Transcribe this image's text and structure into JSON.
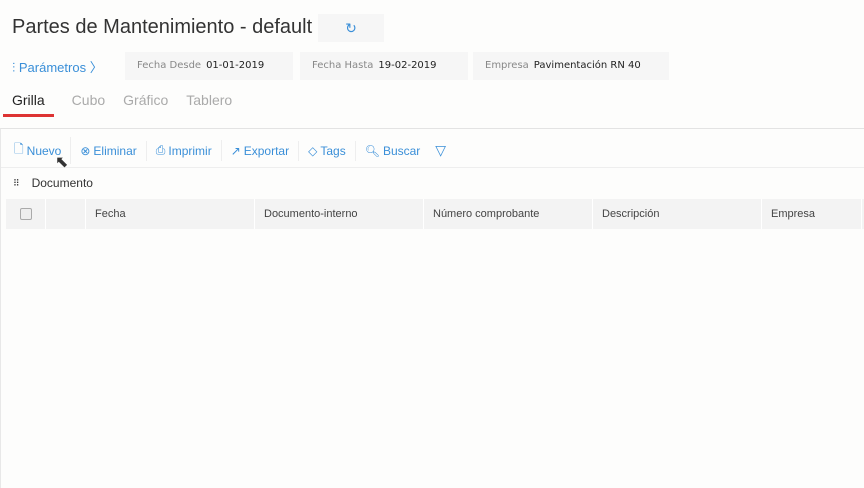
{
  "header": {
    "title": "Partes de Mantenimiento - default",
    "refresh_icon": "refresh-icon"
  },
  "params": {
    "link": "Parámetros",
    "filters": [
      {
        "label": "Fecha Desde",
        "value": "01-01-2019"
      },
      {
        "label": "Fecha Hasta",
        "value": "19-02-2019"
      },
      {
        "label": "Empresa",
        "value": "Pavimentación RN 40"
      }
    ]
  },
  "tabs": [
    "Grilla",
    "Cubo",
    "Gráfico",
    "Tablero"
  ],
  "toolbar": {
    "nuevo": "Nuevo",
    "eliminar": "Eliminar",
    "imprimir": "Imprimir",
    "exportar": "Exportar",
    "tags": "Tags",
    "buscar": "Buscar"
  },
  "group": {
    "label": "Documento"
  },
  "columns": [
    "Fecha",
    "Documento-interno",
    "Número comprobante",
    "Descripción",
    "Empresa"
  ],
  "colors": {
    "accent": "#3a8fd8",
    "tab_underline": "#dd3333"
  }
}
